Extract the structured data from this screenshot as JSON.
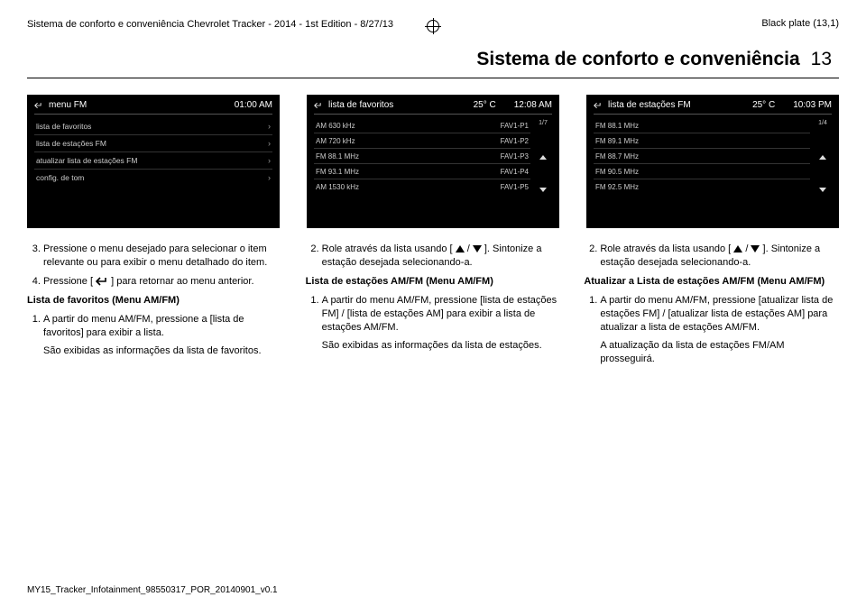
{
  "header": {
    "left_line": "Sistema de conforto e conveniência Chevrolet Tracker - 2014 - 1st Edition - 8/27/13",
    "right_line": "Black plate (13,1)"
  },
  "title": {
    "text": "Sistema de conforto e conveniência",
    "page": "13"
  },
  "screens": {
    "s1": {
      "title": "menu FM",
      "right1": "01:00 AM",
      "items": [
        "lista de favoritos",
        "lista de estações FM",
        "atualizar lista de estações FM",
        "config. de tom"
      ]
    },
    "s2": {
      "title": "lista de favoritos",
      "temp": "25° C",
      "time": "12:08 AM",
      "counter": "1/7",
      "rows": [
        {
          "l": "AM 630 kHz",
          "r": "FAV1-P1"
        },
        {
          "l": "AM 720 kHz",
          "r": "FAV1-P2"
        },
        {
          "l": "FM 88.1 MHz",
          "r": "FAV1-P3"
        },
        {
          "l": "FM 93.1 MHz",
          "r": "FAV1-P4"
        },
        {
          "l": "AM 1530 kHz",
          "r": "FAV1-P5"
        }
      ]
    },
    "s3": {
      "title": "lista de estações FM",
      "temp": "25° C",
      "time": "10:03 PM",
      "counter": "1/4",
      "rows": [
        "FM 88.1 MHz",
        "FM 89.1 MHz",
        "FM 88.7 MHz",
        "FM 90.5 MHz",
        "FM 92.5 MHz"
      ]
    }
  },
  "body": {
    "c1": {
      "li3": "Pressione o menu desejado para selecionar o item relevante ou para exibir o menu detalhado do item.",
      "li4a": "Pressione [",
      "li4b": "] para retornar ao menu anterior.",
      "h1": "Lista de favoritos (Menu AM/FM)",
      "li_b1": "A partir do menu AM/FM, pressione a [lista de favoritos] para exibir a lista.",
      "p1": "São exibidas as informações da lista de favoritos."
    },
    "c2": {
      "li2a": "Role através da lista usando [",
      "li2b": "]. Sintonize a estação desejada selecionando-a.",
      "h1": "Lista de estações AM/FM (Menu AM/FM)",
      "li_b1": "A partir do menu AM/FM, pressione [lista de estações FM] / [lista de estações AM] para exibir a lista de estações AM/FM.",
      "p1": "São exibidas as informações da lista de estações."
    },
    "c3": {
      "li2a": "Role através da lista usando [",
      "li2b": "]. Sintonize a estação desejada selecionando-a.",
      "h1": "Atualizar a Lista de estações AM/FM (Menu AM/FM)",
      "li_b1": "A partir do menu AM/FM, pressione [atualizar lista de estações FM] / [atualizar lista de estações AM] para atualizar a lista de estações AM/FM.",
      "p1": "A atualização da lista de estações FM/AM prosseguirá."
    }
  },
  "footer": {
    "text": "MY15_Tracker_Infotainment_98550317_POR_20140901_v0.1"
  }
}
